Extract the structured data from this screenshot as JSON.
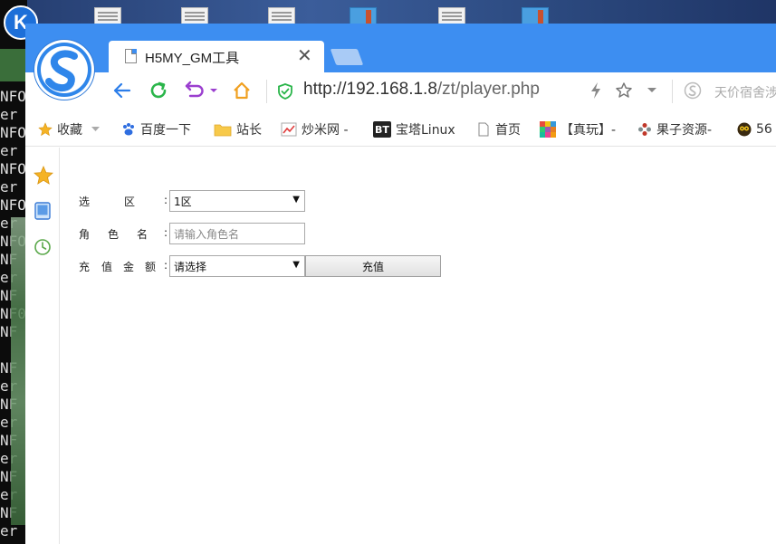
{
  "console": {
    "lines": [
      "NFO",
      "er i",
      "NFO",
      "er i",
      "NFO",
      "er i",
      "NFO",
      "er",
      "NFO",
      "NF",
      "er",
      "NF",
      "NF0 ",
      "NF",
      "",
      "NF",
      "er",
      "NF",
      "er",
      "NF",
      "er",
      "NF",
      "er",
      "NF",
      "er"
    ]
  },
  "desktop": {
    "app_letter": "K"
  },
  "browser": {
    "tab_title": "H5MY_GM工具",
    "tab_close": "✕",
    "url_main": "http://192.168.1.8",
    "url_path": "/zt/player.php",
    "search_hint": "天价宿舍涉",
    "colors": {
      "chrome_blue": "#3d8ef1",
      "back_arrow": "#2b7de9",
      "refresh": "#2ab54a",
      "undo": "#9b3fcf",
      "home": "#f0a020"
    }
  },
  "bookmarks": [
    {
      "label": "收藏",
      "icon": "star-icon"
    },
    {
      "label": "百度一下",
      "icon": "baidu-paw-icon"
    },
    {
      "label": "站长",
      "icon": "folder-icon"
    },
    {
      "label": "炒米网 -",
      "icon": "chart-icon"
    },
    {
      "label": "宝塔Linux",
      "icon": "bt-icon",
      "badge": "BT"
    },
    {
      "label": "首页",
      "icon": "document-icon"
    },
    {
      "label": "【真玩】-",
      "icon": "mosaic-icon"
    },
    {
      "label": "果子资源-",
      "icon": "fruit-icon"
    },
    {
      "label": "56",
      "icon": "owl-icon"
    }
  ],
  "form": {
    "server_label": [
      "选",
      "区",
      ":"
    ],
    "server_value": "1区",
    "role_label": [
      "角",
      "色",
      "名",
      ":"
    ],
    "role_placeholder": "请输入角色名",
    "amount_label": [
      "充",
      "值",
      "金",
      "额",
      ":"
    ],
    "amount_value": "请选择",
    "submit_label": "充值",
    "arrow": "▼"
  }
}
